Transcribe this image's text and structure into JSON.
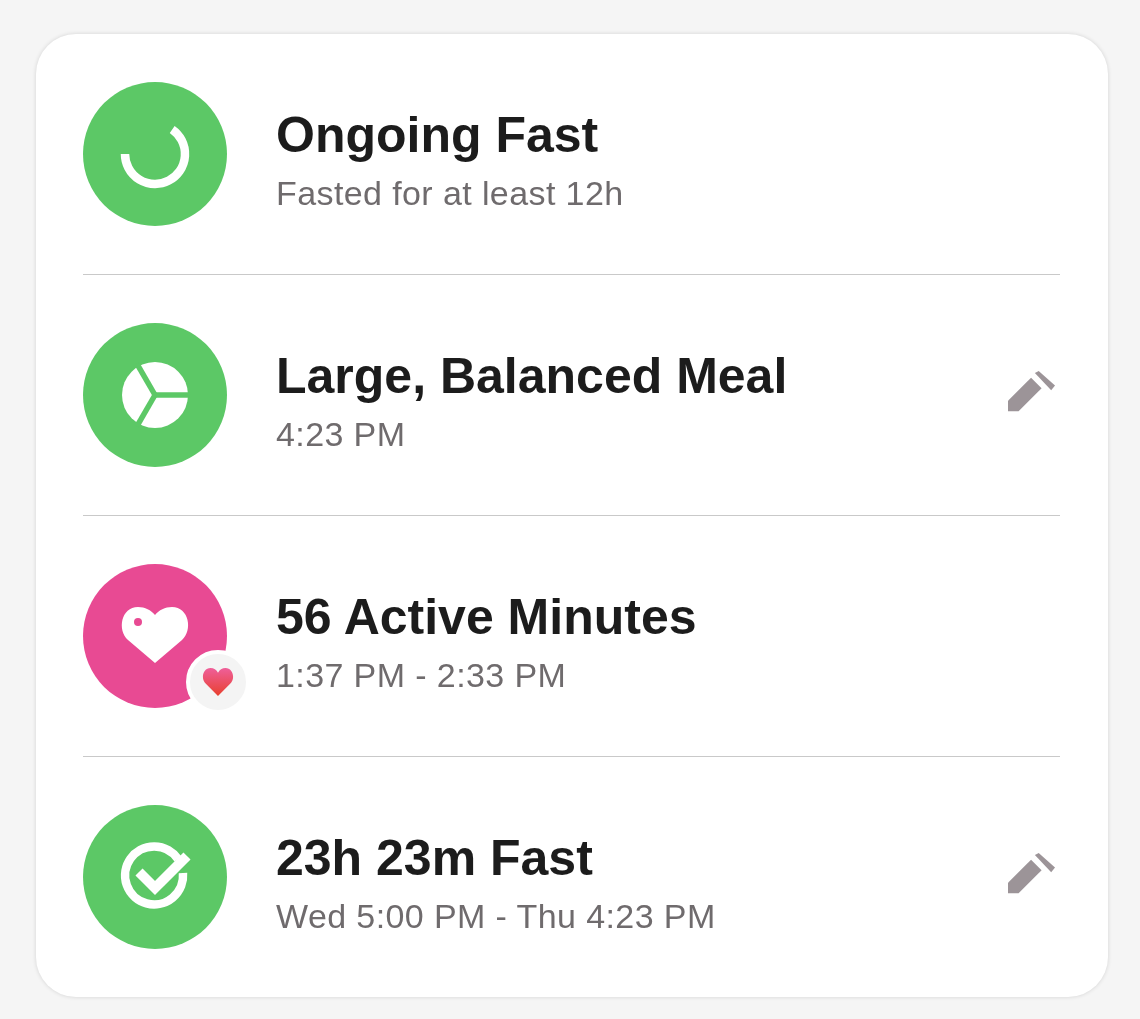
{
  "entries": [
    {
      "kind": "ongoing_fast",
      "color": "#5cc866",
      "title": "Ongoing Fast",
      "subtitle": "Fasted for at least 12h",
      "badge": false,
      "editable": false
    },
    {
      "kind": "meal",
      "color": "#5cc866",
      "title": "Large, Balanced Meal",
      "subtitle": "4:23 PM",
      "badge": false,
      "editable": true
    },
    {
      "kind": "activity",
      "color": "#e84a93",
      "title": "56 Active Minutes",
      "subtitle": "1:37 PM - 2:33 PM",
      "badge": true,
      "editable": false
    },
    {
      "kind": "completed_fast",
      "color": "#5cc866",
      "title": "23h 23m Fast",
      "subtitle": "Wed 5:00 PM - Thu 4:23 PM",
      "badge": false,
      "editable": true
    }
  ]
}
